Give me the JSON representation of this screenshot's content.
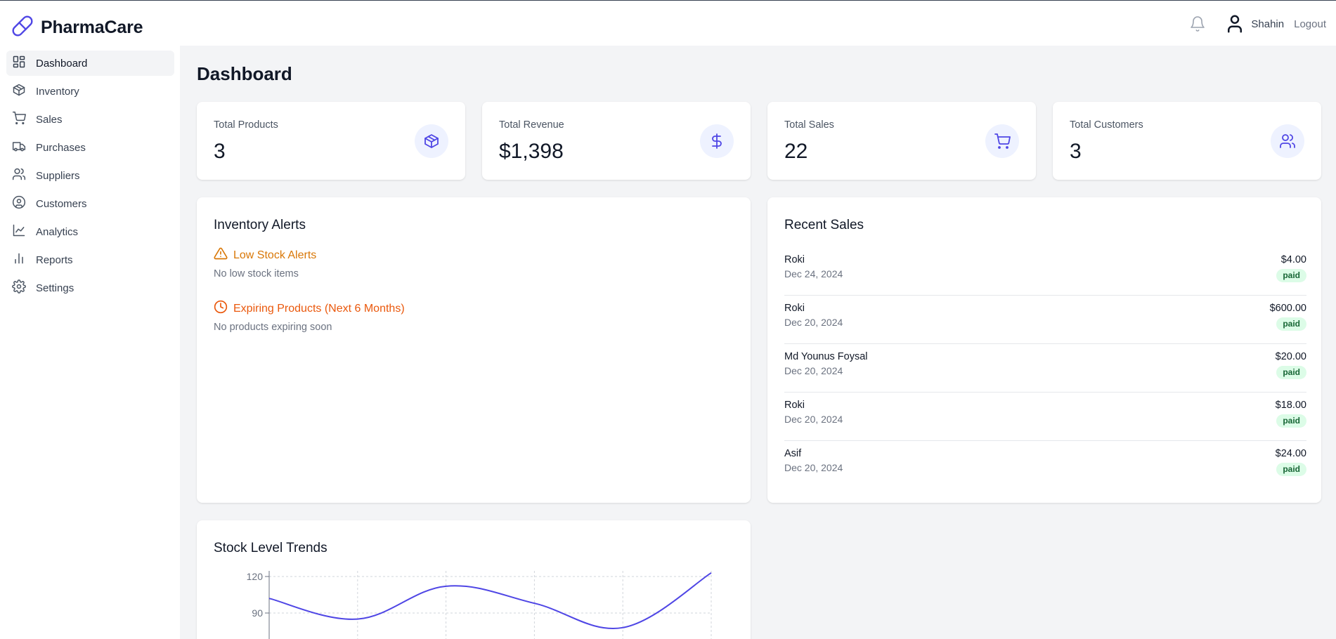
{
  "app": {
    "name": "PharmaCare"
  },
  "header": {
    "user_name": "Shahin",
    "logout_label": "Logout"
  },
  "sidebar": {
    "items": [
      {
        "label": "Dashboard",
        "icon": "dashboard-icon",
        "active": true
      },
      {
        "label": "Inventory",
        "icon": "package-icon"
      },
      {
        "label": "Sales",
        "icon": "cart-icon"
      },
      {
        "label": "Purchases",
        "icon": "truck-icon"
      },
      {
        "label": "Suppliers",
        "icon": "users-icon"
      },
      {
        "label": "Customers",
        "icon": "user-circle-icon"
      },
      {
        "label": "Analytics",
        "icon": "line-chart-icon"
      },
      {
        "label": "Reports",
        "icon": "bar-chart-icon"
      },
      {
        "label": "Settings",
        "icon": "gear-icon"
      }
    ]
  },
  "page": {
    "title": "Dashboard"
  },
  "stats": [
    {
      "label": "Total Products",
      "value": "3",
      "icon": "package-icon"
    },
    {
      "label": "Total Revenue",
      "value": "$1,398",
      "icon": "dollar-icon"
    },
    {
      "label": "Total Sales",
      "value": "22",
      "icon": "cart-icon"
    },
    {
      "label": "Total Customers",
      "value": "3",
      "icon": "users-icon"
    }
  ],
  "inventory_alerts": {
    "title": "Inventory Alerts",
    "low_stock": {
      "title": "Low Stock Alerts",
      "empty_text": "No low stock items",
      "color": "#d97706"
    },
    "expiring": {
      "title": "Expiring Products (Next 6 Months)",
      "empty_text": "No products expiring soon",
      "color": "#ea580c"
    }
  },
  "recent_sales": {
    "title": "Recent Sales",
    "rows": [
      {
        "customer": "Roki",
        "date": "Dec 24, 2024",
        "amount": "$4.00",
        "status": "paid"
      },
      {
        "customer": "Roki",
        "date": "Dec 20, 2024",
        "amount": "$600.00",
        "status": "paid"
      },
      {
        "customer": "Md Younus Foysal",
        "date": "Dec 20, 2024",
        "amount": "$20.00",
        "status": "paid"
      },
      {
        "customer": "Roki",
        "date": "Dec 20, 2024",
        "amount": "$18.00",
        "status": "paid"
      },
      {
        "customer": "Asif",
        "date": "Dec 20, 2024",
        "amount": "$24.00",
        "status": "paid"
      }
    ]
  },
  "stock_trends": {
    "title": "Stock Level Trends"
  },
  "colors": {
    "accent": "#4f46e5",
    "accent_bg": "#eef2ff",
    "paid_bg": "#dcfce7",
    "paid_text": "#166534"
  },
  "chart_data": {
    "type": "line",
    "title": "Stock Level Trends",
    "x": [
      0,
      1,
      2,
      3,
      4,
      5
    ],
    "series": [
      {
        "values": [
          102,
          85,
          112,
          98,
          78,
          123
        ]
      }
    ],
    "yticks_visible": [
      120,
      90
    ],
    "grid": true,
    "color": "#4f46e5"
  }
}
